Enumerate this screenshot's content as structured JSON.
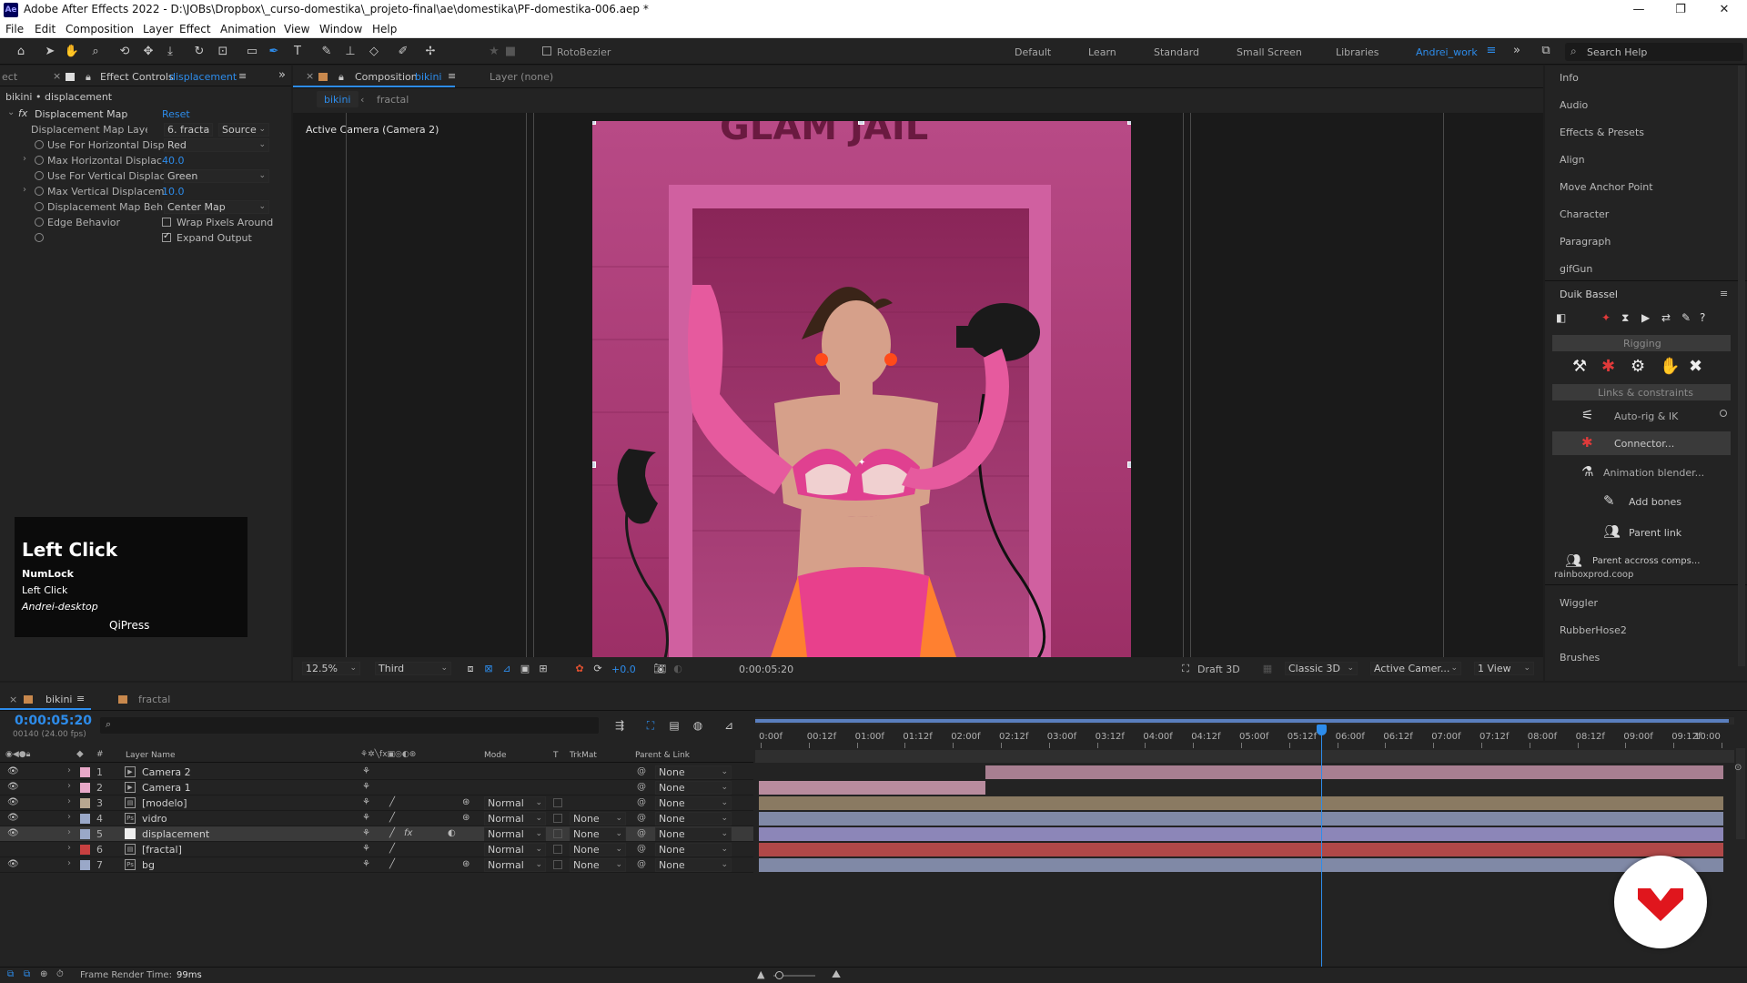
{
  "window": {
    "app_icon": "Ae",
    "title": "Adobe After Effects 2022 - D:\\JOBs\\Dropbox\\_curso-domestika\\_projeto-final\\ae\\domestika\\PF-domestika-006.aep *",
    "controls": [
      "—",
      "❐",
      "✕"
    ]
  },
  "menu": [
    "File",
    "Edit",
    "Composition",
    "Layer",
    "Effect",
    "Animation",
    "View",
    "Window",
    "Help"
  ],
  "toolbar": {
    "rotobezier_label": "RotoBezier",
    "workspaces": [
      "Default",
      "Learn",
      "Standard",
      "Small Screen",
      "Libraries",
      "Andrei_work"
    ],
    "active_workspace": "Andrei_work",
    "search_placeholder": "Search Help"
  },
  "effect_controls": {
    "left_tab_fragment": "ect",
    "tab_prefix": "Effect Controls",
    "tab_layer": "displacement",
    "breadcrumb": "bikini • displacement",
    "effect_name": "Displacement Map",
    "reset_label": "Reset",
    "fx_label": "fx",
    "props": [
      {
        "label": "Displacement Map Layer",
        "value": "6. fracta",
        "value2": "Source"
      },
      {
        "label": "Use For Horizontal Disp",
        "value": "Red"
      },
      {
        "label": "Max Horizontal Displac",
        "value": "40.0"
      },
      {
        "label": "Use For Vertical Displac",
        "value": "Green"
      },
      {
        "label": "Max Vertical Displacem",
        "value": "10.0"
      },
      {
        "label": "Displacement Map Beh",
        "value": "Center Map"
      },
      {
        "label": "Edge Behavior",
        "value": "Wrap Pixels Around"
      },
      {
        "label": "",
        "value": "Expand Output"
      }
    ]
  },
  "key_overlay": {
    "title": "Left Click",
    "line1": "NumLock",
    "line2": "Left Click",
    "line3": "Andrei-desktop",
    "brand": "QiPress"
  },
  "composition": {
    "tab_prefix": "Composition",
    "tab_name": "bikini",
    "layer_tab": "Layer (none)",
    "nav_active": "bikini",
    "nav_other": "fractal",
    "camera_label": "Active Camera (Camera 2)",
    "image_sign": "GLAM JAIL",
    "footer": {
      "zoom": "12.5%",
      "resolution": "Third",
      "exposure": "+0.0",
      "timecode": "0:00:05:20",
      "draft": "Draft 3D",
      "renderer": "Classic 3D",
      "camera": "Active Camer...",
      "views": "1 View"
    }
  },
  "right_panel": {
    "items_top": [
      "Info",
      "Audio",
      "Effects & Presets",
      "Align",
      "Move Anchor Point",
      "Character",
      "Paragraph",
      "gifGun"
    ],
    "duik_title": "Duik Bassel",
    "rigging_label": "Rigging",
    "links_label": "Links & constraints",
    "buttons": [
      "Auto-rig & IK",
      "Connector...",
      "Animation blender...",
      "Add bones",
      "Parent link",
      "Parent accross comps..."
    ],
    "credit": "rainboxprod.coop",
    "items_bottom": [
      "Wiggler",
      "RubberHose2",
      "Brushes"
    ]
  },
  "timeline": {
    "tab_active": "bikini",
    "tab_other": "fractal",
    "timecode": "0:00:05:20",
    "fps": "00140 (24.00 fps)",
    "search_placeholder": "",
    "headers": {
      "num": "#",
      "layer_name": "Layer Name",
      "mode": "Mode",
      "t": "T",
      "trkmat": "TrkMat",
      "parent": "Parent & Link"
    },
    "ruler": [
      "0:00f",
      "00:12f",
      "01:00f",
      "01:12f",
      "02:00f",
      "02:12f",
      "03:00f",
      "03:12f",
      "04:00f",
      "04:12f",
      "05:00f",
      "05:12f",
      "06:00f",
      "06:12f",
      "07:00f",
      "07:12f",
      "08:00f",
      "08:12f",
      "09:00f",
      "09:12f",
      "10:00"
    ],
    "layers": [
      {
        "num": "1",
        "name": "Camera 2",
        "type": "camera",
        "label_color": "#e8a8c8",
        "mode": "",
        "trkmat": "",
        "parent": "None",
        "bar_color": "#a87f91",
        "bar_start": 0.235,
        "bar_end": 1.0
      },
      {
        "num": "2",
        "name": "Camera 1",
        "type": "camera",
        "label_color": "#e8a8c8",
        "mode": "",
        "trkmat": "",
        "parent": "None",
        "bar_color": "#b88c9e",
        "bar_start": 0.0,
        "bar_end": 0.235
      },
      {
        "num": "3",
        "name": "[modelo]",
        "type": "comp",
        "label_color": "#b8a690",
        "mode": "Normal",
        "trkmat": "",
        "parent": "None",
        "bar_color": "#8a7a62",
        "bar_start": 0.0,
        "bar_end": 1.0
      },
      {
        "num": "4",
        "name": "vidro",
        "type": "ps",
        "label_color": "#9aa8c8",
        "mode": "Normal",
        "trkmat": "None",
        "parent": "None",
        "bar_color": "#8089a6",
        "bar_start": 0.0,
        "bar_end": 1.0
      },
      {
        "num": "5",
        "name": "displacement",
        "type": "solid",
        "label_color": "#9aa8c8",
        "mode": "Normal",
        "trkmat": "None",
        "parent": "None",
        "bar_color": "#8c86b8",
        "bar_start": 0.0,
        "bar_end": 1.0,
        "selected": true
      },
      {
        "num": "6",
        "name": "[fractal]",
        "type": "comp",
        "label_color": "#c84040",
        "mode": "Normal",
        "trkmat": "None",
        "parent": "None",
        "bar_color": "#b04848",
        "bar_start": 0.0,
        "bar_end": 1.0
      },
      {
        "num": "7",
        "name": "bg",
        "type": "ps",
        "label_color": "#9aa8c8",
        "mode": "Normal",
        "trkmat": "None",
        "parent": "None",
        "bar_color": "#8089a6",
        "bar_start": 0.0,
        "bar_end": 1.0
      }
    ],
    "playhead_position_fraction": 0.583
  },
  "status": {
    "render_label": "Frame Render Time:",
    "render_value": "99ms"
  },
  "colors": {
    "accent": "#2d8ceb",
    "panel_bg": "#232323",
    "domestika_red": "#e0161d"
  }
}
